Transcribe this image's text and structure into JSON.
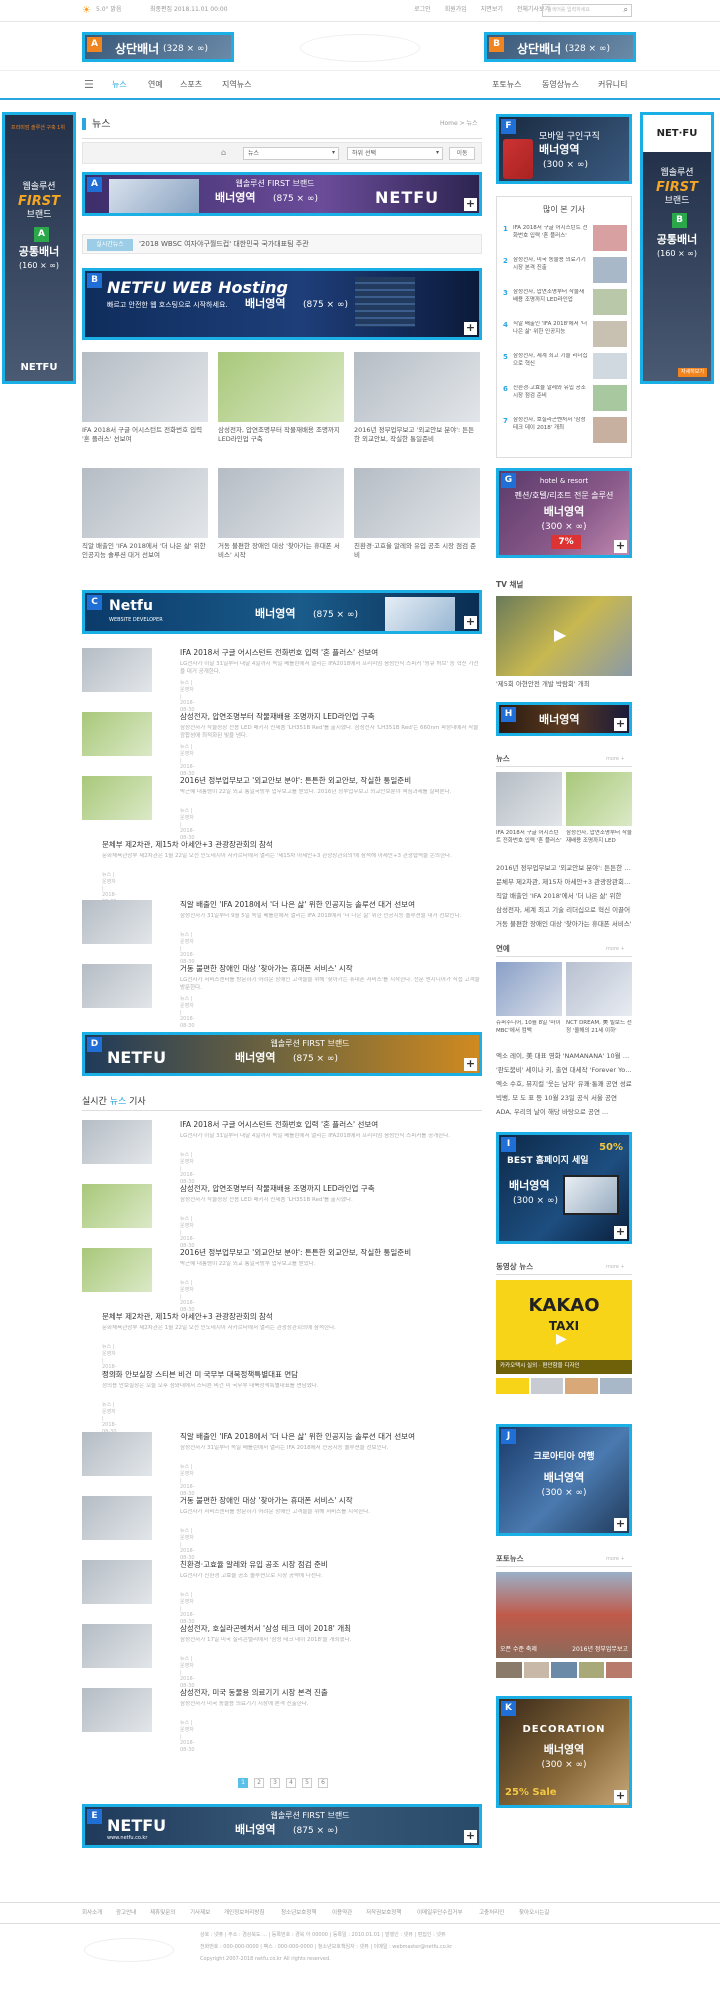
{
  "top": {
    "weather": "5.0° 맑음",
    "updated": "최종편집 2018.11.01 00:00",
    "links": [
      "로그인",
      "회원가입",
      "지면보기",
      "전체기사보기"
    ],
    "search_placeholder": "검색어를 입력하세요"
  },
  "banners": {
    "top_a": {
      "letter": "A",
      "title": "상단배너",
      "size": "(328 × ∞)"
    },
    "top_b": {
      "letter": "B",
      "title": "상단배너",
      "size": "(328 × ∞)"
    },
    "left": {
      "letter": "A",
      "title": "공통배너",
      "size": "(160 × ∞)",
      "top_text": "프리미엄 솔루션 구축 1위",
      "brand1": "웹솔루션",
      "brand2": "FIRST",
      "brand3": "브랜드",
      "foot": "NETFU"
    },
    "right": {
      "letter": "B",
      "title": "공통배너",
      "size": "(160 × ∞)",
      "logo": "NET·FU",
      "brand1": "웹솔루션",
      "brand2": "FIRST",
      "brand3": "브랜드",
      "foot": "자세히보기"
    },
    "ma": {
      "letter": "A",
      "title": "배너영역",
      "size": "(875 × ∞)",
      "sub": "웹솔루션 FIRST 브랜드",
      "brand": "NETFU"
    },
    "mb": {
      "letter": "B",
      "title": "배너영역",
      "size": "(875 × ∞)",
      "head": "NETFU WEB Hosting",
      "sub": "빠르고 안전한 웹 호스팅으로 시작하세요."
    },
    "mc": {
      "letter": "C",
      "title": "배너영역",
      "size": "(875 × ∞)",
      "head": "Netfu",
      "sub": "WEBSITE DEVELOPER"
    },
    "md": {
      "letter": "D",
      "title": "배너영역",
      "size": "(875 × ∞)",
      "sub": "웹솔루션 FIRST 브랜드",
      "brand": "NETFU"
    },
    "me": {
      "letter": "E",
      "title": "배너영역",
      "size": "(875 × ∞)",
      "sub": "웹솔루션 FIRST 브랜드",
      "brand": "NETFU",
      "url": "www.netfu.co.kr"
    },
    "sf": {
      "letter": "F",
      "title": "배너영역",
      "size": "(300 × ∞)",
      "sub": "모바일 구인구직"
    },
    "sg": {
      "letter": "G",
      "title": "배너영역",
      "size": "(300 × ∞)",
      "sub": "펜션/호텔/리조트 전문 솔루션",
      "tag": "hotel & resort",
      "pct": "7%"
    },
    "sh": {
      "letter": "H",
      "title": "배너영역",
      "size": "(300 × ∞)"
    },
    "si": {
      "letter": "I",
      "title": "배너영역",
      "size": "(300 × ∞)",
      "sub": "BEST 홈페이지 세일",
      "pct": "50%"
    },
    "sj": {
      "letter": "J",
      "title": "배너영역",
      "size": "(300 × ∞)",
      "sub": "크로아티아 여행"
    },
    "sk": {
      "letter": "K",
      "title": "배너영역",
      "size": "(300 × ∞)",
      "sub": "DECORATION",
      "pct": "25% Sale"
    }
  },
  "nav": {
    "items": [
      "뉴스",
      "연예",
      "스포츠",
      "지역뉴스"
    ],
    "right": [
      "포토뉴스",
      "동영상뉴스",
      "커뮤니티"
    ]
  },
  "page": {
    "title": "뉴스",
    "breadcrumb": "Home > 뉴스",
    "sel1": "뉴스",
    "sel2": "하위 선택",
    "btn": "이동"
  },
  "live": {
    "label": "실시간뉴스",
    "text": "'2018 WBSC 여자야구월드컵' 대한민국 국가대표팀 주관"
  },
  "photos": [
    {
      "cap": "IFA 2018서 구글 어시스턴트 전화번호 입력 '혼 플러스' 선보여"
    },
    {
      "cap": "삼성전자, 압연조명부터 작물재배용 조명까지 LED라인업 구축"
    },
    {
      "cap": "2016년 정부업무보고 '외교안보 분야': 튼튼한 외교안보, 작실한 통일준비"
    },
    {
      "cap": "직알 배출인 'IFA 2018에서 '더 나은 삶' 위한 인공지능 솔루션 대거 선보여"
    },
    {
      "cap": "거동 불편한 장애인 대상 '찾아가는 휴대폰 서비스' 시작"
    },
    {
      "cap": "친환경·고효율 알레와 유입 공조 시장 점검 준비"
    }
  ],
  "articles": [
    {
      "t": "IFA 2018서 구글 어시스턴트 전화번호 입력 '혼 플러스' 선보여",
      "d": "LG전자가 이달 31일부터 내달 4일까지 독일 베를린에서 열리는 IFA2018에서 프리미엄 음성인식 스피커 '씽큐 허브' 등 혁신 가전을 대거 공개한다.",
      "m": "뉴스 | 운영자 | 2018-08-30"
    },
    {
      "t": "삼성전자, 압연조명부터 작물재배용 조명까지 LED라인업 구축",
      "d": "삼성전자가 작물성장 전용 LED 패키지 신제품 'LH351B Red'를 출시했다. 삼성전자 'LH351B Red'는 660nm 파장대에서 작물 광합성에 최적화된 빛을 낸다.",
      "m": "뉴스 | 운영자 | 2018-08-30"
    },
    {
      "t": "2016년 정부업무보고 '외교안보 분야': 튼튼한 외교안보, 작실한 통일준비",
      "d": "박근혜 대통령이 22일 외교 통일국방부 업무보고를 받았다. 2016년 정부업무보고 외교안보분야 핵심과제를 살펴본다.",
      "m": "뉴스 | 운영자 | 2018-08-30"
    },
    {
      "t": "문체부 제2차관, 제15차 아세안+3 관광장관회의 참석",
      "d": "문화체육관광부 제2차관은 1월 22일 오전 인도네시아 자카르타에서 열리는 '제15차 아세안+3 관광장관회의'에 참석해 아세안+3 관광협력을 논의한다.",
      "m": "뉴스 | 운영자 | 2018-08-30"
    },
    {
      "t": "직알 배출인 'IFA 2018에서 '더 나은 삶' 위한 인공지능 솔루션 대거 선보여",
      "d": "삼성전자가 31일부터 9월 5일 독일 베를린에서 열리는 IFA 2018에서 '더 나은 삶' 위한 인공지능 솔루션을 대거 선보인다.",
      "m": "뉴스 | 운영자 | 2018-08-30"
    },
    {
      "t": "거동 불편한 장애인 대상 '찾아가는 휴대폰 서비스' 시작",
      "d": "LG전자가 서비스센터를 방문하기 어려운 장애인 고객들을 위해 '찾아가는 휴대폰 서비스'를 시작한다. 전문 엔지니어가 직접 고객을 방문한다.",
      "m": "뉴스 | 운영자 | 2018-08-30"
    }
  ],
  "realtime": {
    "title_a": "실시간",
    "title_b": "뉴스",
    "title_c": "기사"
  },
  "rt_articles": [
    {
      "t": "IFA 2018서 구글 어시스턴트 전화번호 입력 '혼 플러스' 선보여",
      "d": "LG전자가 이달 31일부터 내달 4일까지 독일 베를린에서 열리는 IFA2018에서 프리미엄 음성인식 스피커를 공개한다.",
      "m": "뉴스 | 운영자 | 2018-08-30",
      "img": true
    },
    {
      "t": "삼성전자, 압연조명부터 작물재배용 조명까지 LED라인업 구축",
      "d": "삼성전자가 작물성장 전용 LED 패키지 신제품 'LH351B Red'를 출시했다.",
      "m": "뉴스 | 운영자 | 2018-08-30",
      "img": true
    },
    {
      "t": "2016년 정부업무보고 '외교안보 분야': 튼튼한 외교안보, 작실한 통일준비",
      "d": "박근혜 대통령이 22일 외교 통일국방부 업무보고를 받았다.",
      "m": "뉴스 | 운영자 | 2018-08-30",
      "img": true
    },
    {
      "t": "문체부 제2차관, 제15차 아세안+3 관광장관회의 참석",
      "d": "문화체육관광부 제2차관은 1월 22일 오전 인도네시아 자카르타에서 열리는 관광장관회의에 참석한다.",
      "m": "뉴스 | 운영자 | 2018-08-30",
      "img": false
    },
    {
      "t": "정의화 안보실장 스티븐 비건 미 국무부 대북정책특별대표 면담",
      "d": "정의용 안보실장은 오늘 오후 청와대에서 스티븐 비건 미 국무부 대북정책특별대표를 면담했다.",
      "m": "뉴스 | 운영자 | 2018-08-30",
      "img": false
    },
    {
      "t": "직알 배출인 'IFA 2018에서 '더 나은 삶' 위한 인공지능 솔루션 대거 선보여",
      "d": "삼성전자가 31일부터 독일 베를린에서 열리는 IFA 2018에서 인공지능 솔루션을 선보인다.",
      "m": "뉴스 | 운영자 | 2018-08-30",
      "img": true
    },
    {
      "t": "거동 불편한 장애인 대상 '찾아가는 휴대폰 서비스' 시작",
      "d": "LG전자가 서비스센터를 방문하기 어려운 장애인 고객들을 위해 서비스를 시작한다.",
      "m": "뉴스 | 운영자 | 2018-08-30",
      "img": true
    },
    {
      "t": "친환경·고효율 알레와 유입 공조 시장 점검 준비",
      "d": "LG전자가 친환경 고효율 공조 솔루션으로 시장 공략에 나선다.",
      "m": "뉴스 | 운영자 | 2018-08-30",
      "img": true
    },
    {
      "t": "삼성전자, 호실라곤벤처서 '삼성 테크 데이 2018' 개최",
      "d": "삼성전자가 17일 미국 실리콘밸리에서 '삼성 테크 데이 2018'을 개최했다.",
      "m": "뉴스 | 운영자 | 2018-08-30",
      "img": true
    },
    {
      "t": "삼성전자, 미국 동물용 의료기기 시장 본격 진출",
      "d": "삼성전자가 미국 동물용 의료기기 시장에 본격 진출한다.",
      "m": "뉴스 | 운영자 | 2018-08-30",
      "img": true
    }
  ],
  "pages": [
    "1",
    "2",
    "3",
    "4",
    "5",
    "6"
  ],
  "popular": {
    "title": "많이 본 기사",
    "items": [
      "IFA 2018서 구글 어시스턴트 전화번호 입력 '혼 플러스'",
      "삼성전자, 미국 동물용 의료기기 시장 본격 진출",
      "삼성전자, 압연조명부터 작물재배용 조명까지 LED라인업",
      "직알 배출인 'IFA 2018'에서 '더 나은 삶' 위한 인공지능",
      "삼성전자, 세계 최고 기술 리더십으로 혁신",
      "친환경·고효율 알레와 유입 공조 시장 점검 준비",
      "삼성전자, 호실라곤벤처서 '삼성 테크 데이 2018' 개최"
    ]
  },
  "channel": {
    "title": "TV 채널",
    "cap": "'제5회 아현안전 개발 박람회' 개최"
  },
  "side_news": {
    "title": "뉴스",
    "more": "more +",
    "caps": [
      "IFA 2018서 구글 어시스턴트 전화번호 입력 '혼 플러스'",
      "삼성전자, 압연조명부터 작물재배용 조명까지 LED"
    ],
    "list": [
      "2016년 정부업무보고 '외교안보 분야': 튼튼한 외교",
      "문체부 제2차관, 제15차 아세안+3 관광장관회의 참석",
      "직알 배출인 'IFA 2018'에서 '더 나은 삶' 위한",
      "삼성전자, 세계 최고 기술 리더십으로 혁신 이끌어",
      "거동 불편한 장애인 대상 '찾아가는 휴대폰 서비스'"
    ]
  },
  "side_ent": {
    "title": "연예",
    "more": "more +",
    "caps": [
      "슈퍼주니어, 10월 8일 '마이 MBC'에서 컴백",
      "NCT DREAM, 美 빌보드 선정 '올해의 21세 이하'"
    ],
    "list": [
      "엑소 레이, 美 대표 영화 'NAMANANA' 10월 출연",
      "'판도붐비' 세이나 키, 출연 대세작 'Forever Young'",
      "엑소 수호, 뮤지컬 '웃는 남자' 유쾌·통쾌 공연 성료",
      "빅뱅, 모 도 표 등 10월 23일 공식 서울 공연",
      "ADA, 우리의 날이 해당 바탕으로 공연 ..."
    ]
  },
  "side_video": {
    "title": "동영상 뉴스",
    "more": "more +",
    "logo": "KAKAO",
    "sub": "TAXI",
    "cap": "카카오택시 실외 · 편안함을 디자인"
  },
  "side_photo": {
    "title": "포토뉴스",
    "more": "more +",
    "caps": [
      "오픈 수준 축제",
      "2016년 정부업무보고"
    ]
  },
  "footer": {
    "nav": [
      "회사소개",
      "광고안내",
      "제휴및문의",
      "기사제보",
      "개인정보처리방침",
      "청소년보호정책",
      "이용약관",
      "저작권보호정책",
      "이메일무단수집거부",
      "고충처리인",
      "찾아오시는길"
    ],
    "lines": [
      "상호 : 넷퓨 | 주소 : 경상북도 ... | 등록번호 : 경북 아 00000 | 등록일 : 2010.01.01 | 발행인 : 넷퓨 | 편집인 : 넷퓨",
      "전화번호 : 000-000-0000 | 팩스 : 000-000-0000 | 청소년보호책임자 : 넷퓨 | 이메일 : webmaster@netfu.co.kr",
      "Copyright 2007-2018 netfu.co.kr All rights reserved."
    ]
  }
}
